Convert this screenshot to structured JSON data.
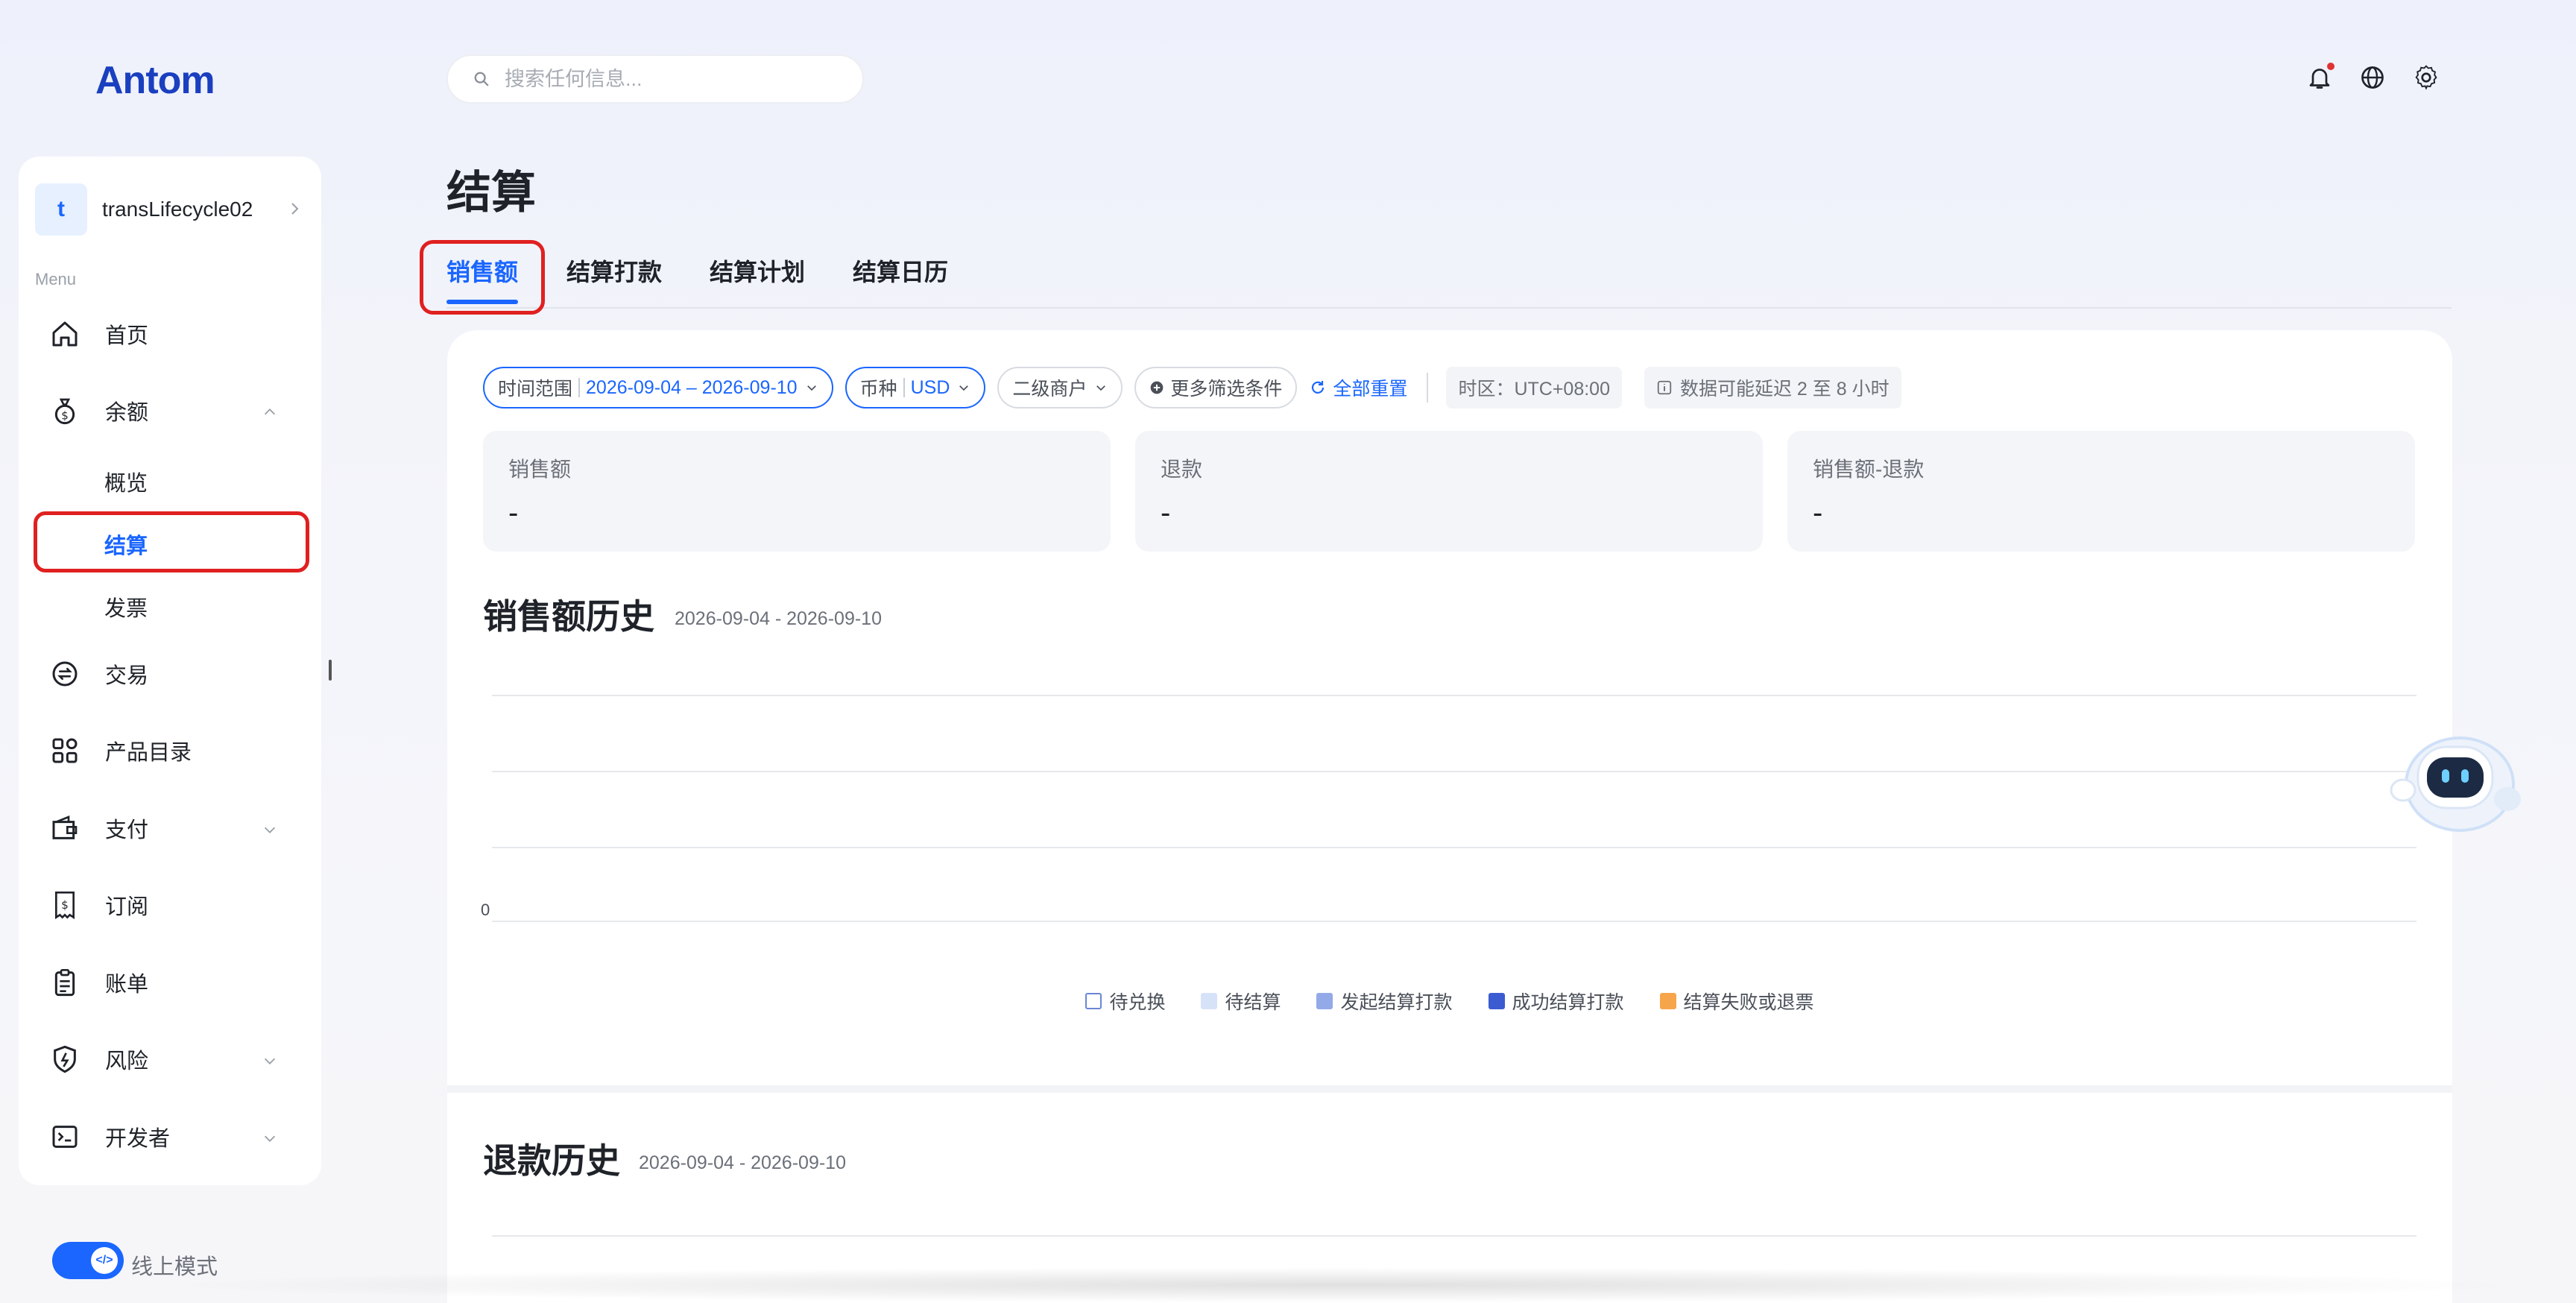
{
  "brand": {
    "logo_text": "Antom"
  },
  "search": {
    "placeholder": "搜索任何信息..."
  },
  "account": {
    "avatar_letter": "t",
    "name": "transLifecycle02"
  },
  "menu": {
    "title": "Menu",
    "items": [
      {
        "label": "首页",
        "icon": "home-icon"
      },
      {
        "label": "余额",
        "icon": "money-bag-icon",
        "expanded": true,
        "children": [
          {
            "label": "概览"
          },
          {
            "label": "结算",
            "active": true
          },
          {
            "label": "发票"
          }
        ]
      },
      {
        "label": "交易",
        "icon": "exchange-icon"
      },
      {
        "label": "产品目录",
        "icon": "grid-icon"
      },
      {
        "label": "支付",
        "icon": "wallet-icon",
        "collapsible": true
      },
      {
        "label": "订阅",
        "icon": "receipt-icon"
      },
      {
        "label": "账单",
        "icon": "clipboard-icon"
      },
      {
        "label": "风险",
        "icon": "shield-icon",
        "collapsible": true
      },
      {
        "label": "开发者",
        "icon": "terminal-icon",
        "collapsible": true
      }
    ]
  },
  "mode_toggle": {
    "label": "线上模式",
    "on": true
  },
  "page": {
    "title": "结算",
    "tabs": [
      {
        "label": "销售额",
        "active": true
      },
      {
        "label": "结算打款"
      },
      {
        "label": "结算计划"
      },
      {
        "label": "结算日历"
      }
    ]
  },
  "filters": {
    "time_range_label": "时间范围",
    "time_range_value": "2026-09-04 – 2026-09-10",
    "currency_label": "币种",
    "currency_value": "USD",
    "merchant_label": "二级商户",
    "more_filters": "更多筛选条件",
    "reset": "全部重置",
    "timezone": "时区：UTC+08:00",
    "delay_notice": "数据可能延迟 2 至 8 小时"
  },
  "metrics": [
    {
      "label": "销售额",
      "value": "-"
    },
    {
      "label": "退款",
      "value": "-"
    },
    {
      "label": "销售额-退款",
      "value": "-"
    }
  ],
  "sales_history": {
    "title": "销售额历史",
    "date_range": "2026-09-04 - 2026-09-10",
    "y_zero_label": "0",
    "legend": [
      {
        "name": "待兑换",
        "color": "#ffffff",
        "outline": "#6b86d6"
      },
      {
        "name": "待结算",
        "color": "#d6e2f8"
      },
      {
        "name": "发起结算打款",
        "color": "#93a9e8"
      },
      {
        "name": "成功结算打款",
        "color": "#3b5bd1"
      },
      {
        "name": "结算失败或退票",
        "color": "#f7a54a"
      }
    ]
  },
  "refund_history": {
    "title": "退款历史",
    "date_range": "2026-09-04 - 2026-09-10"
  },
  "colors": {
    "accent": "#1a66ff",
    "highlight_box": "#e02020"
  }
}
